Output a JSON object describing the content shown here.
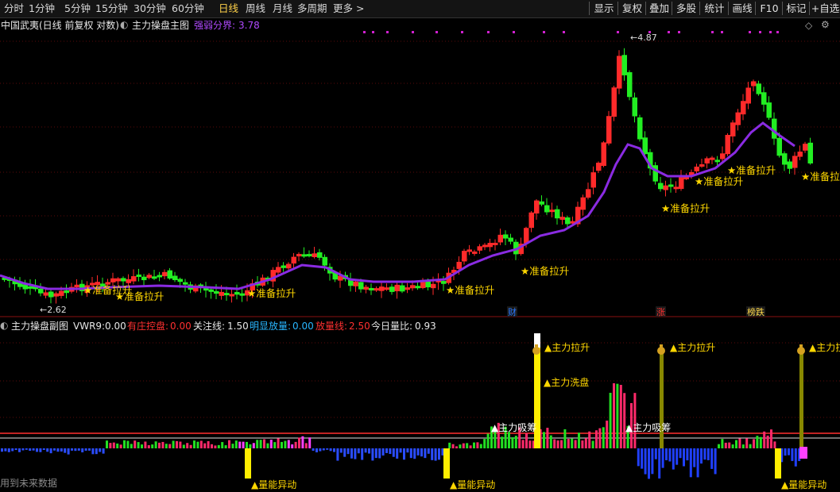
{
  "toolbar": {
    "periods": [
      "分时",
      "1分钟",
      "5分钟",
      "15分钟",
      "30分钟",
      "60分钟",
      "日线",
      "周线",
      "月线",
      "多周期",
      "更多 >"
    ],
    "active_period": "日线",
    "right_buttons": [
      "显示",
      "复权",
      "叠加",
      "多股",
      "统计",
      "画线",
      "F10",
      "标记",
      "+自选"
    ]
  },
  "main": {
    "stock_title": "中国武夷(日线 前复权 对数)",
    "indicator_name": "主力操盘主图",
    "strength_label": "强弱分界:",
    "strength_value": "3.78",
    "high_marker": "4.87",
    "low_marker": "2.62",
    "signal_text": "准备拉升",
    "event_tags": [
      "财",
      "涨",
      "榜跌"
    ],
    "colors": {
      "up": "#ff2a2a",
      "down": "#22ee22",
      "ma": "#8a2be2",
      "signal": "#ffd700",
      "bg": "#000000"
    }
  },
  "sub": {
    "indicator_name": "主力操盘副图",
    "vwr9_label": "VWR9:",
    "vwr9_value": "0.00",
    "control_label": "有庄控盘:",
    "control_value": "0.00",
    "focus_label": "关注线:",
    "focus_value": "1.50",
    "obvious_label": "明显放量:",
    "obvious_value": "0.00",
    "volume_label": "放量线:",
    "volume_value": "2.50",
    "ratio_label": "今日量比:",
    "ratio_value": "0.93",
    "future_data_note": "用到未来数据",
    "signals": {
      "pull_up": "▲主力拉升",
      "wash": "▲主力洗盘",
      "absorb": "▲主力吸筹",
      "volume_anomaly": "▲量能异动"
    }
  }
}
